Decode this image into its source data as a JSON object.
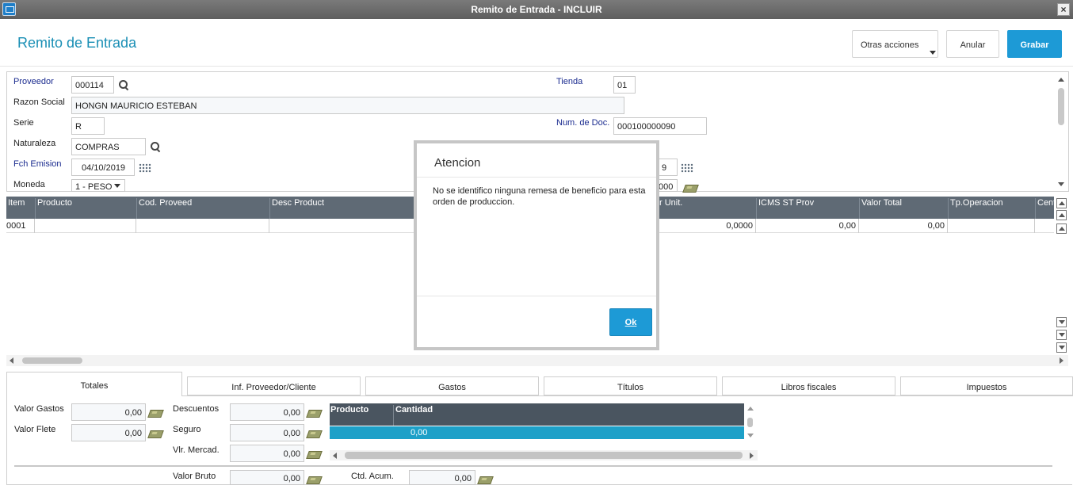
{
  "window": {
    "title": "Remito de Entrada - INCLUIR",
    "close_label": "×"
  },
  "header": {
    "title": "Remito de Entrada",
    "other_actions": "Otras acciones",
    "cancel": "Anular",
    "save": "Grabar"
  },
  "form": {
    "proveedor_label": "Proveedor",
    "proveedor_value": "000114",
    "tienda_label": "Tienda",
    "tienda_value": "01",
    "razon_label": "Razon Social",
    "razon_value": "HONGN MAURICIO ESTEBAN",
    "serie_label": "Serie",
    "serie_value": "R",
    "numdoc_label": "Num. de Doc.",
    "numdoc_value": "000100000090",
    "naturaleza_label": "Naturaleza",
    "naturaleza_value": "COMPRAS",
    "fch_label": "Fch Emision",
    "fch_value": "04/10/2019",
    "date2_partial": "9",
    "moneda_label": "Moneda",
    "moneda_value": "1 - PESO",
    "partial_value": "000"
  },
  "grid": {
    "columns": [
      "Item",
      "Producto",
      "Cod. Proveed",
      "Desc Product",
      "r Unit.",
      "ICMS ST Prov",
      "Valor Total",
      "Tp.Operacion",
      "Centr"
    ],
    "rows": [
      {
        "item": "0001",
        "unit": "0,0000",
        "icms": "0,00",
        "total": "0,00"
      }
    ]
  },
  "tabs": [
    "Totales",
    "Inf. Proveedor/Cliente",
    "Gastos",
    "Títulos",
    "Libros fiscales",
    "Impuestos"
  ],
  "totals": {
    "gastos_label": "Valor Gastos",
    "gastos_value": "0,00",
    "flete_label": "Valor Flete",
    "flete_value": "0,00",
    "desc_label": "Descuentos",
    "desc_value": "0,00",
    "seguro_label": "Seguro",
    "seguro_value": "0,00",
    "mercad_label": "Vlr. Mercad.",
    "mercad_value": "0,00",
    "bruto_label": "Valor Bruto",
    "bruto_value": "0,00",
    "acum_label": "Ctd. Acum.",
    "acum_value": "0,00",
    "mini_cols": [
      "Producto",
      "Cantidad"
    ],
    "mini_row_value": "0,00"
  },
  "modal": {
    "title": "Atencion",
    "message": "No se identifico ninguna remesa de beneficio para esta orden de produccion.",
    "ok": "Ok"
  },
  "colors": {
    "accent": "#1d9ad6",
    "title_blue": "#1a8fb5",
    "grid_header": "#5f6a75"
  }
}
